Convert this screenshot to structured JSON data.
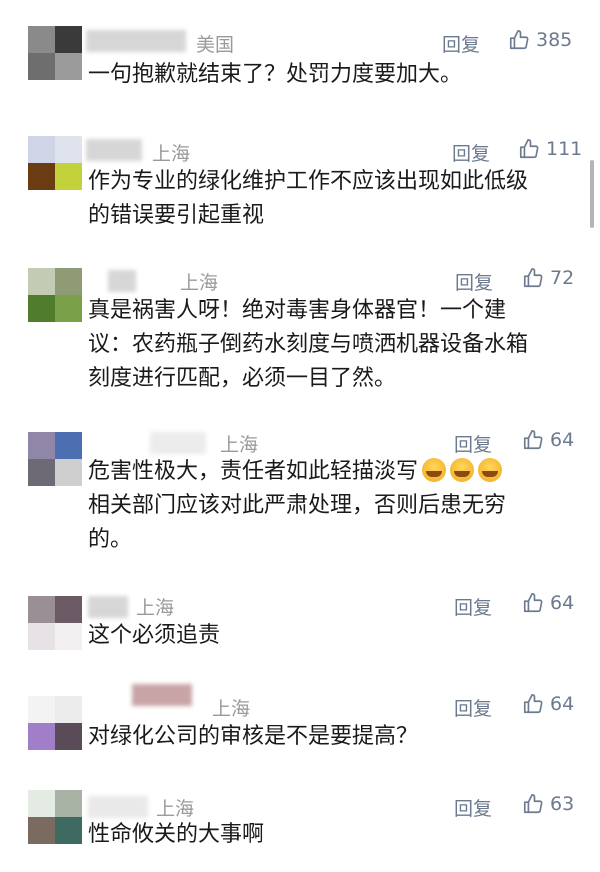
{
  "ui": {
    "reply_label": "回复",
    "like_icon": "thumbs-up-icon",
    "reply_color": "#6b7a8f",
    "location_color": "#9a9a9a"
  },
  "comments": [
    {
      "location": "美国",
      "likes": "385",
      "lines": [
        "一句抱歉就结束了？处罚力度要加大。"
      ]
    },
    {
      "location": "上海",
      "likes": "111",
      "lines": [
        "作为专业的绿化维护工作不应该出现如此低级",
        "的错误要引起重视"
      ]
    },
    {
      "location": "上海",
      "likes": "72",
      "lines": [
        "真是祸害人呀！绝对毒害身体器官！一个建",
        "议：农药瓶子倒药水刻度与喷洒机器设备水箱",
        "刻度进行匹配，必须一目了然。"
      ]
    },
    {
      "location": "上海",
      "likes": "64",
      "lines": [
        "危害性极大，责任者如此轻描淡写",
        "相关部门应该对此严肃处理，否则后患无穷",
        "的。"
      ]
    },
    {
      "location": "上海",
      "likes": "64",
      "lines": [
        "这个必须追责"
      ]
    },
    {
      "location": "上海",
      "likes": "64",
      "lines": [
        "对绿化公司的审核是不是要提高？"
      ]
    },
    {
      "location": "上海",
      "likes": "63",
      "lines": [
        "性命攸关的大事啊"
      ]
    }
  ]
}
